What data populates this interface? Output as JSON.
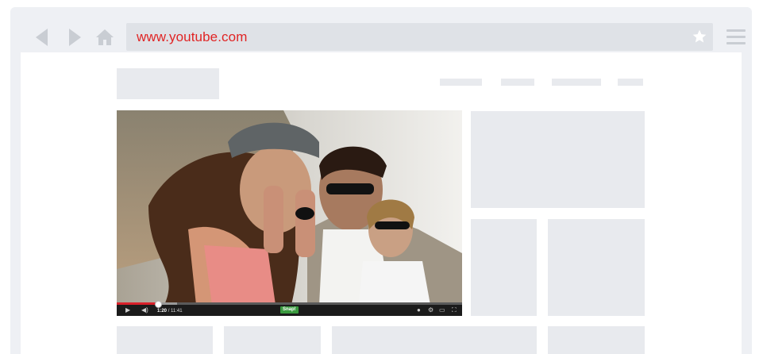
{
  "browser": {
    "url": "www.youtube.com",
    "colors": {
      "chrome": "#eef0f4",
      "url_text": "#e02424",
      "placeholder": "#e8eaee"
    },
    "icons": [
      "back-arrow-icon",
      "forward-arrow-icon",
      "home-icon",
      "star-icon",
      "hamburger-menu-icon"
    ]
  },
  "video_player": {
    "current_time": "1:20",
    "duration": "/ 11:41",
    "snap_label": "Snap!",
    "progress": 0.12
  }
}
